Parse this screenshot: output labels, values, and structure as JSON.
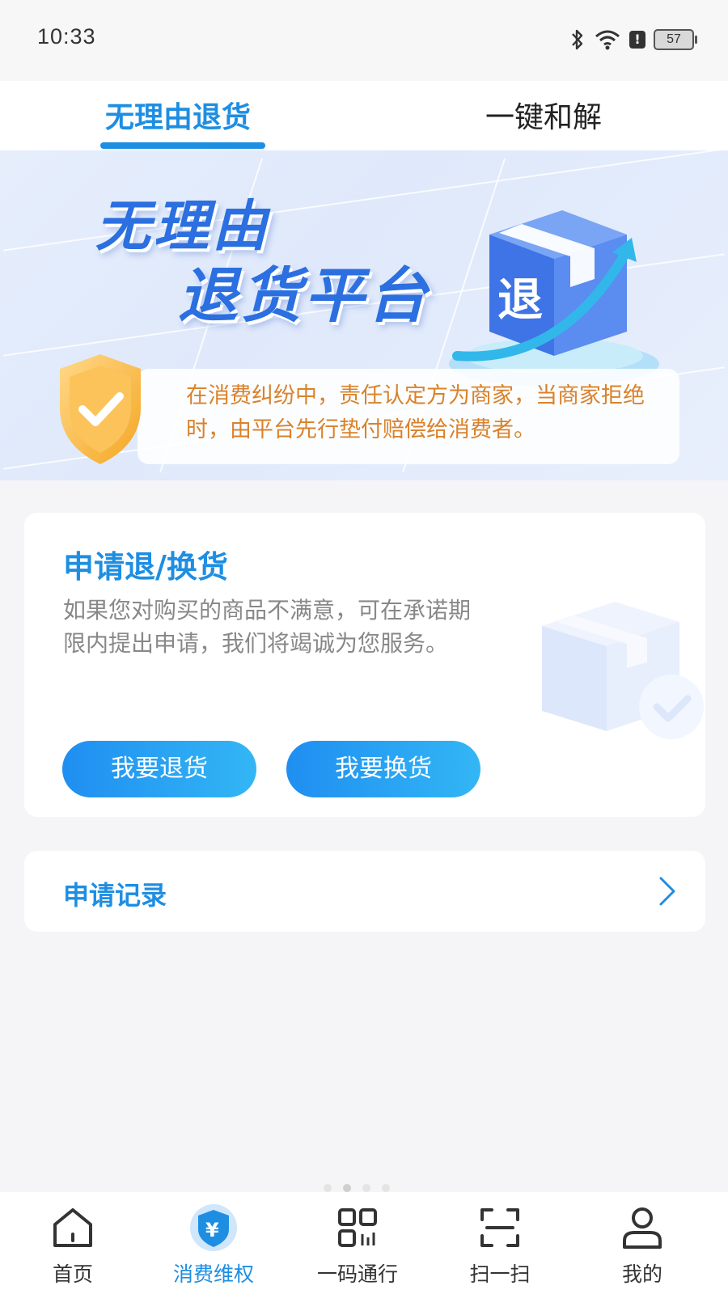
{
  "status_bar": {
    "time": "10:33",
    "battery": "57",
    "alert": "!"
  },
  "tabs": [
    {
      "label": "无理由退货",
      "active": true
    },
    {
      "label": "一键和解",
      "active": false
    }
  ],
  "banner": {
    "title_line1": "无理由",
    "title_line2": "退货平台",
    "box_label": "退",
    "info": "在消费纠纷中，责任认定方为商家，当商家拒绝时，由平台先行垫付赔偿给消费者。"
  },
  "apply_card": {
    "title": "申请退/换货",
    "description": "如果您对购买的商品不满意，可在承诺期限内提出申请，我们将竭诚为您服务。",
    "return_button": "我要退货",
    "exchange_button": "我要换货"
  },
  "records": {
    "label": "申请记录"
  },
  "bottom_nav": [
    {
      "label": "首页",
      "icon": "home-icon"
    },
    {
      "label": "消费维权",
      "icon": "yuan-shield-icon",
      "active": true
    },
    {
      "label": "一码通行",
      "icon": "qr-code-icon"
    },
    {
      "label": "扫一扫",
      "icon": "scan-icon"
    },
    {
      "label": "我的",
      "icon": "user-icon"
    }
  ],
  "colors": {
    "accent": "#1e8ee2",
    "info_text": "#d9822b",
    "title_blue": "#2b6fe0"
  }
}
